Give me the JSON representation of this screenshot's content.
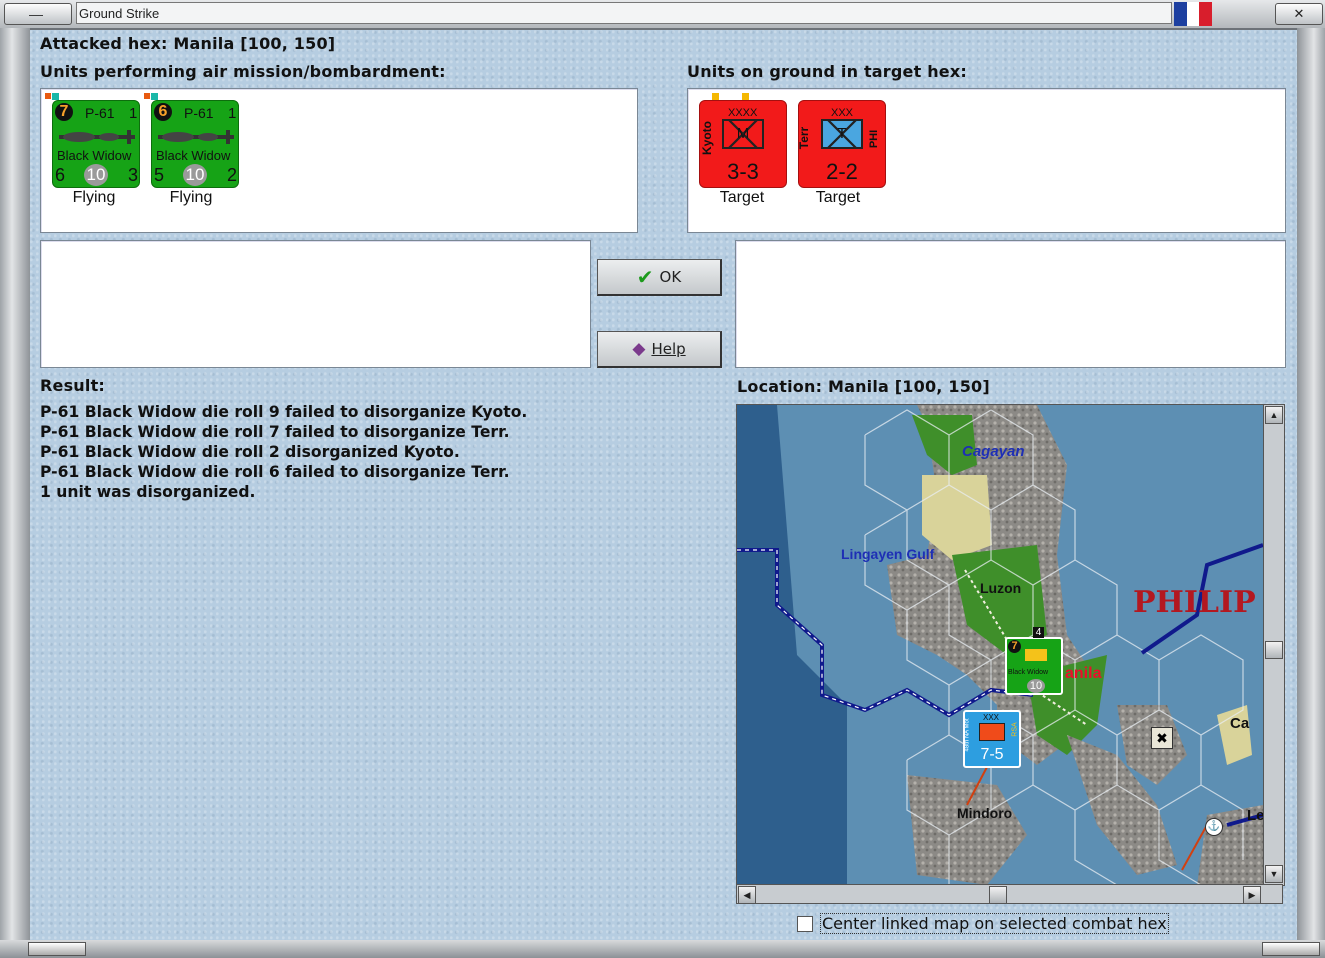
{
  "window": {
    "title": "Ground Strike"
  },
  "header": {
    "attacked_hex": "Attacked hex: Manila  [100, 150]",
    "air_units_label": "Units performing air mission/bombardment:",
    "ground_units_label": "Units on ground in target hex:"
  },
  "air_units": [
    {
      "id_num": "7",
      "type": "P-61",
      "corner": "1",
      "name": "Black Widow",
      "left": "6",
      "center": "10",
      "right": "3",
      "status": "Flying"
    },
    {
      "id_num": "6",
      "type": "P-61",
      "corner": "1",
      "name": "Black Widow",
      "left": "5",
      "center": "10",
      "right": "2",
      "status": "Flying"
    }
  ],
  "ground_units": [
    {
      "side_label": "Kyoto",
      "size": "XXXX",
      "symbol": "M",
      "strength": "3-3",
      "status": "Target",
      "color": "#f21a1a"
    },
    {
      "side_label": "Terr",
      "size": "XXX",
      "symbol": "T",
      "nation": "PHI",
      "strength": "2-2",
      "status": "Target",
      "color": "#f21a1a"
    }
  ],
  "buttons": {
    "ok": "OK",
    "help": "Help"
  },
  "result": {
    "label": "Result:",
    "lines": [
      "P-61 Black Widow die roll 9 failed to disorganize Kyoto.",
      "P-61 Black Widow die roll 7 failed to disorganize Terr.",
      "P-61 Black Widow die roll 2 disorganized Kyoto.",
      "P-61 Black Widow die roll 6 failed to disorganize Terr.",
      "1 unit was disorganized."
    ]
  },
  "location": {
    "label": "Location:  Manila  [100, 150]",
    "map_labels": {
      "cagayan": "Cagayan",
      "lingayen": "Lingayen Gulf",
      "luzon": "Luzon",
      "philip": "PHILIP",
      "manila": "anila",
      "mindoro": "Mindoro",
      "ca": "Ca",
      "le": "Le"
    },
    "map_counter_air": {
      "id_num": "7",
      "top": "4",
      "name": "Black Widow",
      "value": "10"
    },
    "map_counter_ground": {
      "size": "XXX",
      "side": "48th NA Mot",
      "nation": "RSA",
      "strength": "7-5"
    }
  },
  "checkbox": {
    "label": "Center linked map on selected combat hex",
    "checked": false
  },
  "colors": {
    "panel_bg": "#b6cde1",
    "air_green": "#16a316",
    "enemy_red": "#f21a1a",
    "sea": "#2e5f8d"
  }
}
